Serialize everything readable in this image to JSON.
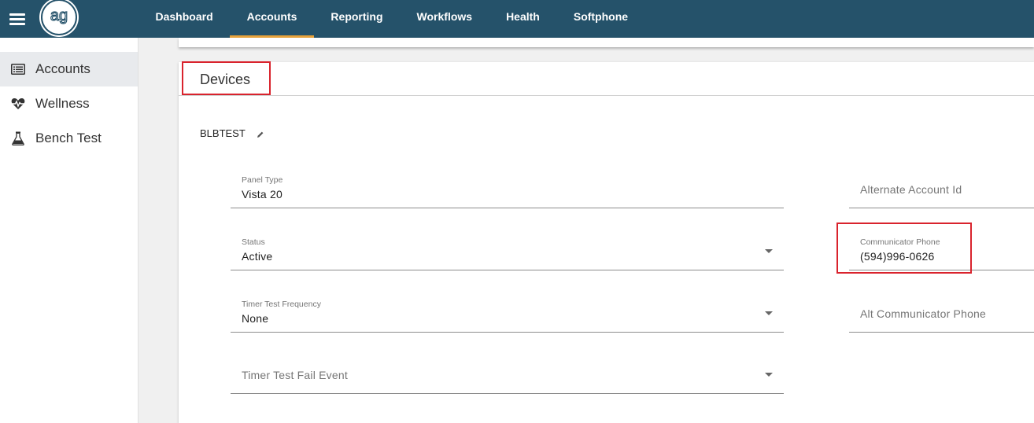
{
  "topbar": {
    "logo_text": "ag",
    "nav": [
      {
        "label": "Dashboard"
      },
      {
        "label": "Accounts"
      },
      {
        "label": "Reporting"
      },
      {
        "label": "Workflows"
      },
      {
        "label": "Health"
      },
      {
        "label": "Softphone"
      }
    ],
    "active_nav": "Accounts"
  },
  "sidebar": {
    "items": [
      {
        "label": "Accounts",
        "icon": "account-list-icon"
      },
      {
        "label": "Wellness",
        "icon": "heartbeat-icon"
      },
      {
        "label": "Bench Test",
        "icon": "flask-icon"
      }
    ]
  },
  "devices": {
    "title": "Devices",
    "device_name": "BLBTEST",
    "fields": {
      "panel_type": {
        "label": "Panel Type",
        "value": "Vista 20"
      },
      "status": {
        "label": "Status",
        "value": "Active"
      },
      "timer_test_frequency": {
        "label": "Timer Test Frequency",
        "value": "None"
      },
      "timer_test_fail_event": {
        "placeholder": "Timer Test Fail Event"
      },
      "alternate_account_id": {
        "placeholder": "Alternate Account Id"
      },
      "communicator_phone": {
        "label": "Communicator Phone",
        "value": "(594)996-0626"
      },
      "alt_communicator_phone": {
        "placeholder": "Alt Communicator Phone"
      }
    }
  },
  "colors": {
    "topbar": "#25526a",
    "active_tab_underline": "#e8a33a",
    "highlight": "#d9232d"
  }
}
